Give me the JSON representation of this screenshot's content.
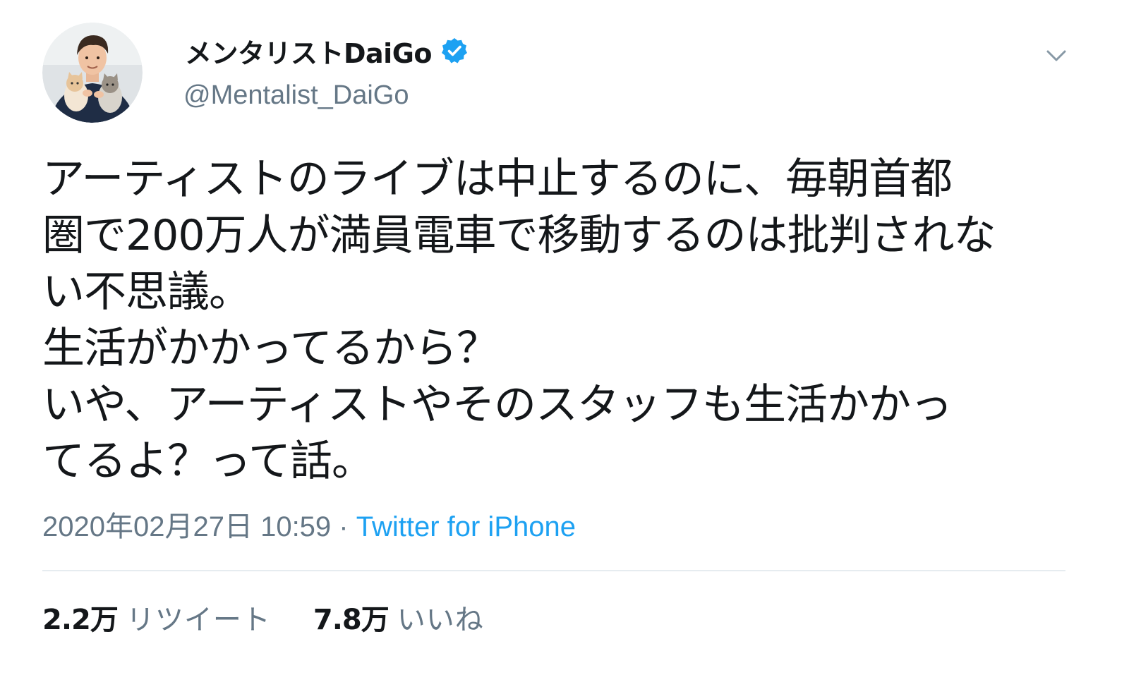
{
  "colors": {
    "text_primary": "#14171a",
    "text_secondary": "#657786",
    "accent": "#1da1f2",
    "verified_badge": "#1da1f2",
    "divider": "#e6ecf0"
  },
  "author": {
    "display_name": "メンタリストDaiGo",
    "handle": "@Mentalist_DaiGo",
    "verified": true,
    "avatar_icon": "profile-photo-avatar"
  },
  "header": {
    "menu_icon": "chevron-down-icon"
  },
  "tweet": {
    "text_lines": [
      "アーティストのライブは中止するのに、毎朝首都",
      "圏で200万人が満員電車で移動するのは批判されな",
      "い不思議。",
      "生活がかかってるから？",
      "いや、アーティストやそのスタッフも生活かかっ",
      "てるよ？って話。"
    ],
    "timestamp": "2020年02月27日 10:59",
    "separator": " · ",
    "source": "Twitter for iPhone"
  },
  "stats": {
    "retweets": {
      "count": "2.2万",
      "label": "リツイート"
    },
    "likes": {
      "count": "7.8万",
      "label": "いいね"
    }
  }
}
